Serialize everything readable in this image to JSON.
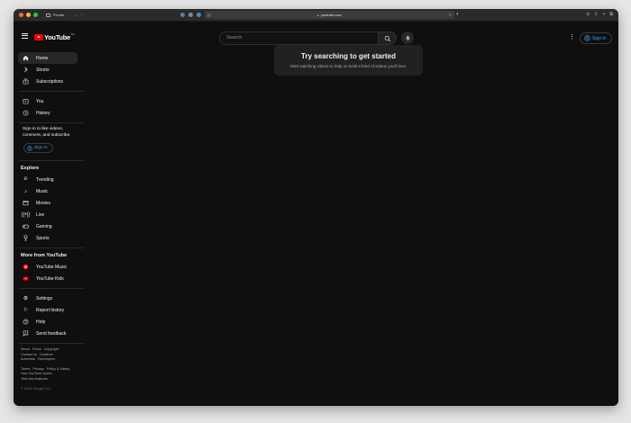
{
  "browser": {
    "private_label": "Private",
    "url": "youtube.com"
  },
  "header": {
    "logo_text": "YouTube",
    "region": "RU",
    "search_placeholder": "Search",
    "signin_label": "Sign in"
  },
  "sidebar": {
    "primary": [
      {
        "label": "Home",
        "icon": "home-icon"
      },
      {
        "label": "Shorts",
        "icon": "shorts-icon"
      },
      {
        "label": "Subscriptions",
        "icon": "subscriptions-icon"
      }
    ],
    "personal": [
      {
        "label": "You",
        "icon": "you-icon"
      },
      {
        "label": "History",
        "icon": "history-icon"
      }
    ],
    "signin_note": "Sign in to like videos, comment, and subscribe.",
    "signin_label": "Sign in",
    "explore_title": "Explore",
    "explore": [
      {
        "label": "Trending",
        "icon": "trending-icon"
      },
      {
        "label": "Music",
        "icon": "music-icon"
      },
      {
        "label": "Movies",
        "icon": "movies-icon"
      },
      {
        "label": "Live",
        "icon": "live-icon"
      },
      {
        "label": "Gaming",
        "icon": "gaming-icon"
      },
      {
        "label": "Sports",
        "icon": "sports-icon"
      }
    ],
    "more_title": "More from YouTube",
    "more": [
      {
        "label": "YouTube Music",
        "icon": "youtube-music-icon"
      },
      {
        "label": "YouTube Kids",
        "icon": "youtube-kids-icon"
      }
    ],
    "settings": [
      {
        "label": "Settings",
        "icon": "gear-icon"
      },
      {
        "label": "Report history",
        "icon": "flag-icon"
      },
      {
        "label": "Help",
        "icon": "help-icon"
      },
      {
        "label": "Send feedback",
        "icon": "feedback-icon"
      }
    ],
    "footer_row1": [
      "About",
      "Press",
      "Copyright"
    ],
    "footer_row2": [
      "Contact us",
      "Creators"
    ],
    "footer_row3": [
      "Advertise",
      "Developers"
    ],
    "footer_row4": [
      "Terms",
      "Privacy",
      "Policy & Safety"
    ],
    "footer_row5": [
      "How YouTube works"
    ],
    "footer_row6": [
      "Test new features"
    ],
    "copyright": "© 2024 Google LLC"
  },
  "main": {
    "title": "Try searching to get started",
    "subtitle": "Start watching videos to help us build a feed of videos you'll love."
  },
  "colors": {
    "background": "#0f0f0f",
    "accent_blue": "#3ea6ff",
    "brand_red": "#ff0000"
  }
}
